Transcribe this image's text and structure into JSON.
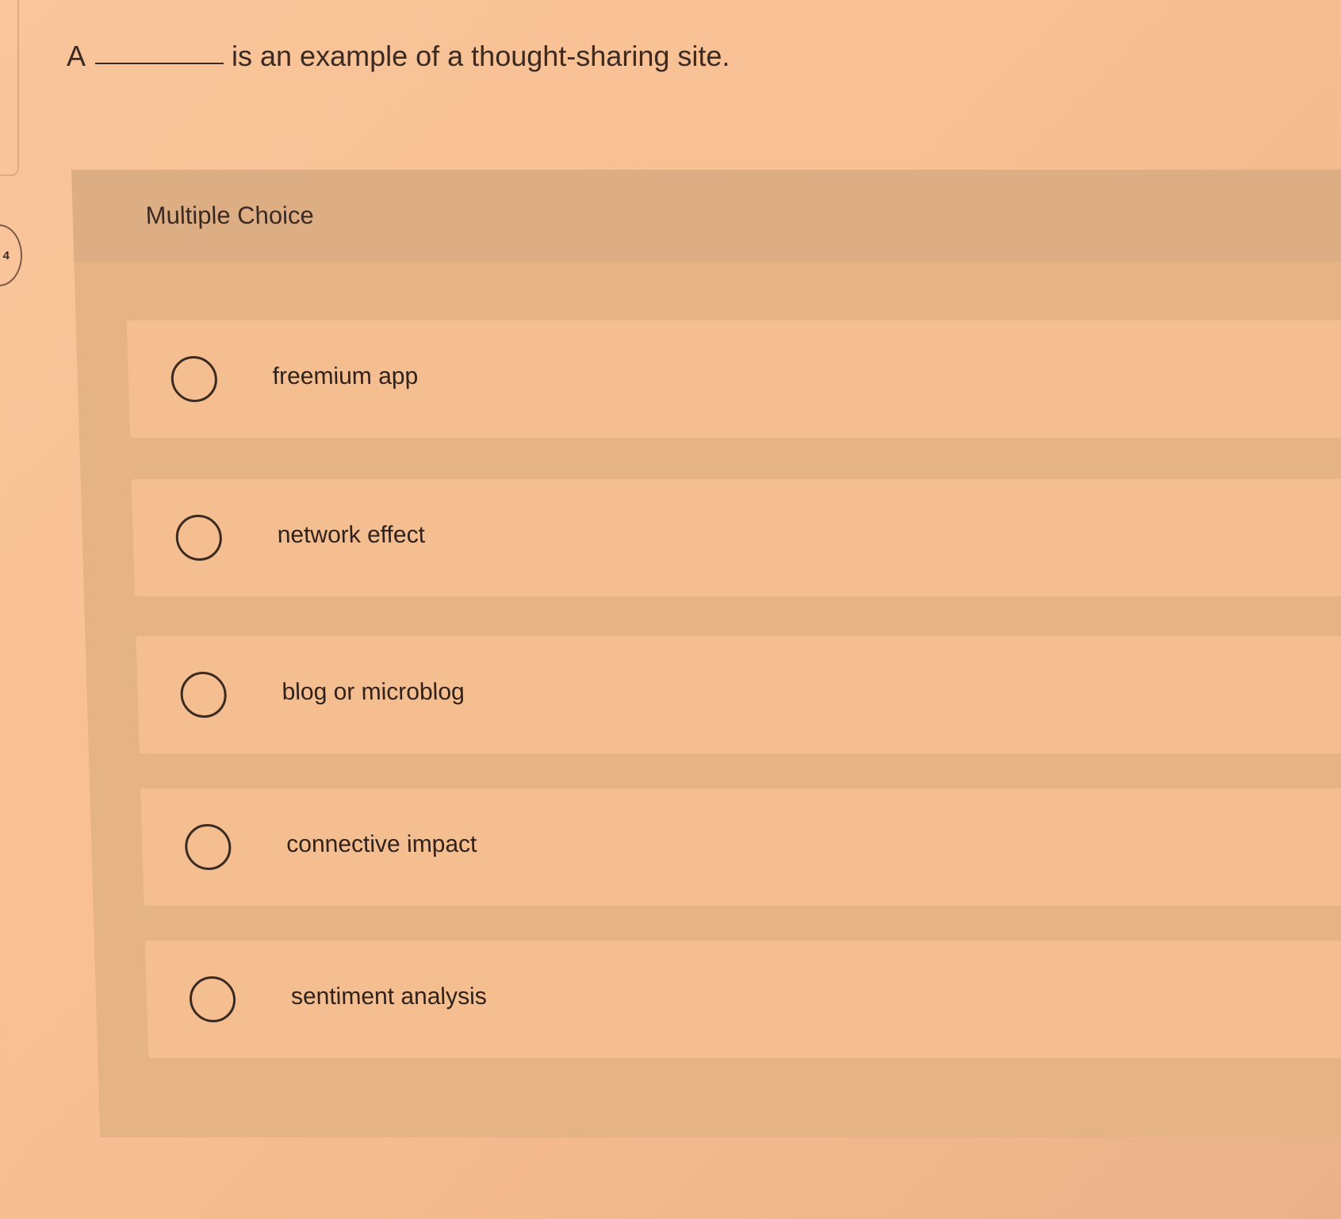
{
  "question": {
    "prefix": "A",
    "suffix": "is an example of a thought-sharing site."
  },
  "badge": {
    "number": "4"
  },
  "panel": {
    "title": "Multiple Choice"
  },
  "options": [
    {
      "label": "freemium app"
    },
    {
      "label": "network effect"
    },
    {
      "label": "blog or microblog"
    },
    {
      "label": "connective impact"
    },
    {
      "label": "sentiment analysis"
    }
  ]
}
